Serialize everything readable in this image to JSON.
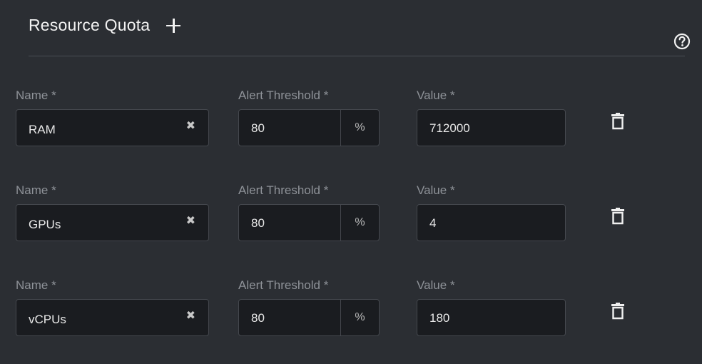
{
  "section": {
    "title": "Resource Quota",
    "add_icon": "plus-icon",
    "help_icon": "help-circle-icon"
  },
  "labels": {
    "name": "Name *",
    "threshold": "Alert Threshold *",
    "value": "Value *",
    "percent_suffix": "%"
  },
  "quotas": [
    {
      "name": "RAM",
      "threshold": "80",
      "value": "712000"
    },
    {
      "name": "GPUs",
      "threshold": "80",
      "value": "4"
    },
    {
      "name": "vCPUs",
      "threshold": "80",
      "value": "180"
    }
  ],
  "icons": {
    "clear": "✖",
    "delete": "trash-icon"
  },
  "colors": {
    "background": "#2b2e33",
    "field_bg": "#1a1c20",
    "label": "#8e9298"
  }
}
